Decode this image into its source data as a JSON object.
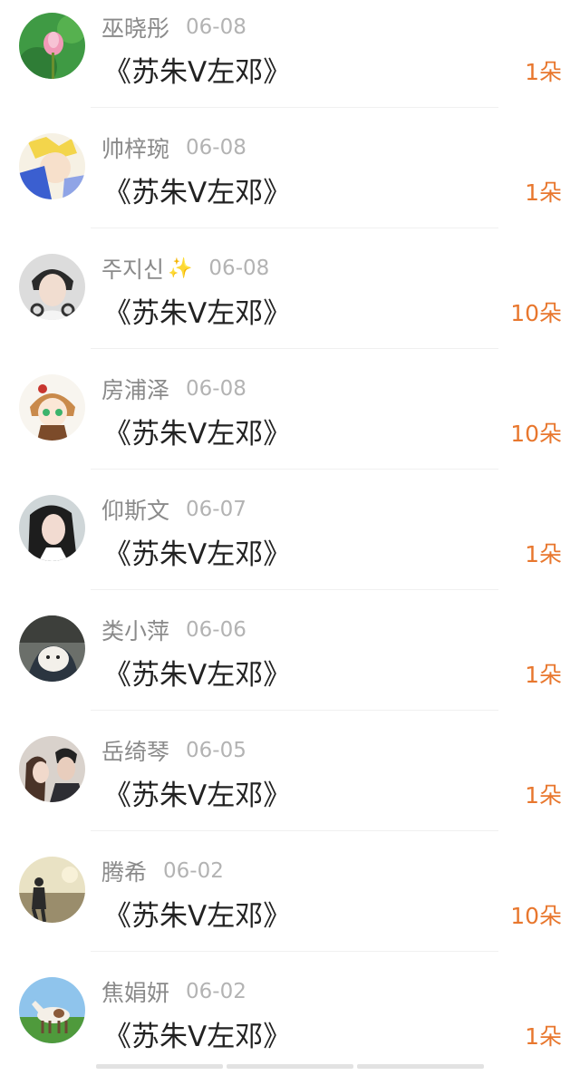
{
  "rows": [
    {
      "name": "巫晓彤",
      "date": "06-08",
      "title": "《苏朱V左邓》",
      "count": "1朵",
      "sparkle": false
    },
    {
      "name": "帅梓琬",
      "date": "06-08",
      "title": "《苏朱V左邓》",
      "count": "1朵",
      "sparkle": false
    },
    {
      "name": "주지신",
      "date": "06-08",
      "title": "《苏朱V左邓》",
      "count": "10朵",
      "sparkle": true
    },
    {
      "name": "房浦泽",
      "date": "06-08",
      "title": "《苏朱V左邓》",
      "count": "10朵",
      "sparkle": false
    },
    {
      "name": "仰斯文",
      "date": "06-07",
      "title": "《苏朱V左邓》",
      "count": "1朵",
      "sparkle": false
    },
    {
      "name": "类小萍",
      "date": "06-06",
      "title": "《苏朱V左邓》",
      "count": "1朵",
      "sparkle": false
    },
    {
      "name": "岳绮琴",
      "date": "06-05",
      "title": "《苏朱V左邓》",
      "count": "1朵",
      "sparkle": false
    },
    {
      "name": "腾希",
      "date": "06-02",
      "title": "《苏朱V左邓》",
      "count": "10朵",
      "sparkle": false
    },
    {
      "name": "焦娟妍",
      "date": "06-02",
      "title": "《苏朱V左邓》",
      "count": "1朵",
      "sparkle": false
    }
  ],
  "sparkle_glyph": "✨",
  "colors": {
    "name": "#8a8a8a",
    "date": "#b3b3b3",
    "title": "#222222",
    "count": "#e8772e"
  }
}
